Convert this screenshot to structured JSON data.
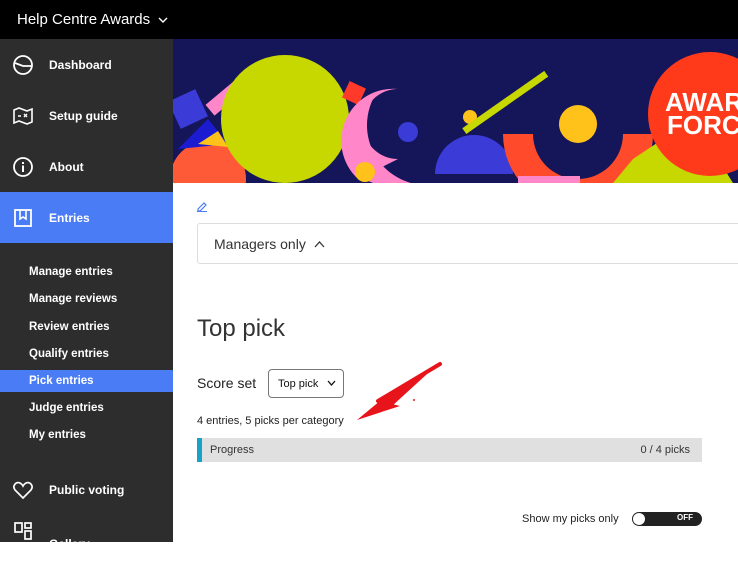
{
  "app": {
    "title": "Help Centre Awards"
  },
  "sidebar": {
    "main_items": [
      {
        "label": "Dashboard",
        "icon": "dashboard-icon"
      },
      {
        "label": "Setup guide",
        "icon": "map-icon"
      },
      {
        "label": "About",
        "icon": "info-icon"
      },
      {
        "label": "Entries",
        "icon": "bookmark-icon",
        "active": true
      }
    ],
    "sub_items": [
      {
        "label": "Manage entries"
      },
      {
        "label": "Manage reviews"
      },
      {
        "label": "Review entries"
      },
      {
        "label": "Qualify entries"
      },
      {
        "label": "Pick entries",
        "active": true
      },
      {
        "label": "Judge entries"
      },
      {
        "label": "My entries"
      }
    ],
    "bottom_items": [
      {
        "label": "Public voting",
        "icon": "heart-icon"
      },
      {
        "label": "Gallery",
        "icon": "gallery-icon"
      }
    ]
  },
  "banner": {
    "logo_text_1": "AWAR",
    "logo_text_2": "FORC"
  },
  "main": {
    "managers_label": "Managers only",
    "title": "Top pick",
    "score_set_label": "Score set",
    "score_set_value": "Top pick",
    "entries_info": "4 entries, 5 picks per category",
    "progress_label": "Progress",
    "progress_value": "0 / 4 picks",
    "show_picks_label": "Show my picks only",
    "toggle_state": "OFF"
  },
  "colors": {
    "accent": "#4a7cf6",
    "progress_bar": "#17a3c8",
    "annotation_arrow": "#e8141b"
  }
}
